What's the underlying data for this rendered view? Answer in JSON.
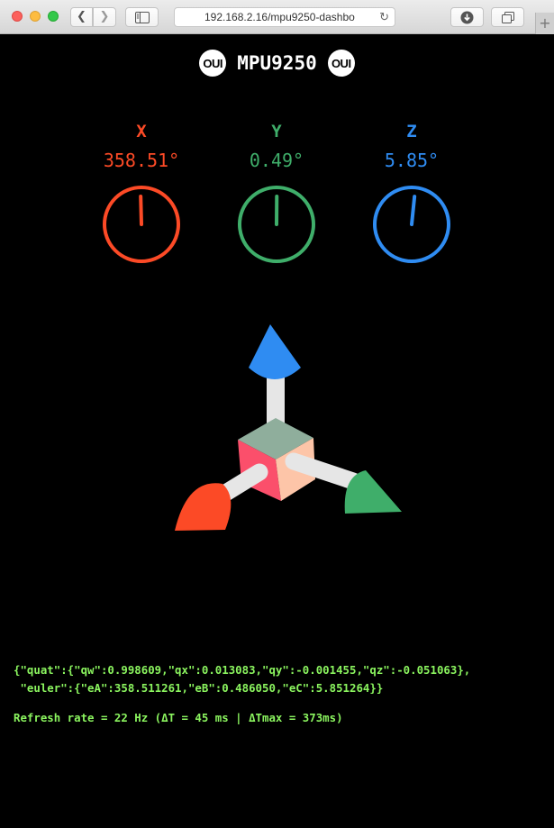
{
  "browser": {
    "url": "192.168.2.16/mpu9250-dashbo",
    "new_tab_symbol": "+"
  },
  "header": {
    "title": "MPU9250",
    "logo_text": "OUI"
  },
  "axes": [
    {
      "label": "X",
      "value": "358.51°",
      "angle_deg": 358.51,
      "color": "#fc4a26"
    },
    {
      "label": "Y",
      "value": "0.49°",
      "angle_deg": 0.49,
      "color": "#3fae6a"
    },
    {
      "label": "Z",
      "value": "5.85°",
      "angle_deg": 5.85,
      "color": "#2f8cf2"
    }
  ],
  "data_output": {
    "json_line_1": "{\"quat\":{\"qw\":0.998609,\"qx\":0.013083,\"qy\":-0.001455,\"qz\":-0.051063},",
    "json_line_2": " \"euler\":{\"eA\":358.511261,\"eB\":0.486050,\"eC\":5.851264}}",
    "refresh_text": "Refresh rate = 22 Hz (ΔT = 45 ms | ΔTmax = 373ms)"
  },
  "colors": {
    "text_green": "#8bf55f",
    "background": "#000000"
  }
}
